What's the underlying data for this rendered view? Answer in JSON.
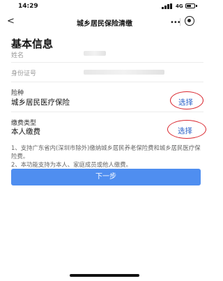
{
  "status_bar": {
    "time": "14:29",
    "network": "4G"
  },
  "nav": {
    "back": "<",
    "title": "城乡居民保险清缴",
    "more": "•••"
  },
  "section": {
    "title": "基本信息"
  },
  "personal": {
    "name_label": "姓名",
    "id_label": "身份证号"
  },
  "insurance": {
    "label": "险种",
    "value": "城乡居民医疗保险",
    "select_label": "选择"
  },
  "payment": {
    "label": "缴费类型",
    "value": "本人缴费",
    "select_label": "选择"
  },
  "notes": [
    "1、支持广东省内(深圳市除外)缴纳城乡居民养老保险费和城乡居民医疗保险费。",
    "2、本功能支持为本人、家庭成员或他人缴费。"
  ],
  "next_button": {
    "label": "下一步"
  },
  "colors": {
    "accent": "#2d63c8",
    "button": "#4f8ef0",
    "annotation": "#d9262e"
  }
}
